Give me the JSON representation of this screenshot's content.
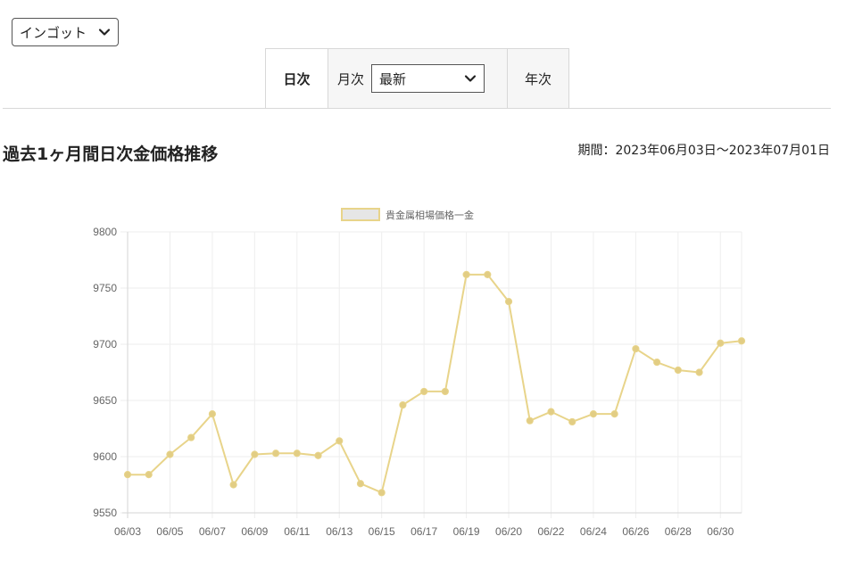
{
  "product_select": {
    "value": "インゴット"
  },
  "tabs": {
    "daily_label": "日次",
    "monthly_label": "月次",
    "monthly_select_value": "最新",
    "yearly_label": "年次"
  },
  "heading": {
    "title": "過去1ヶ月間日次金価格推移",
    "period": "期間：2023年06月03日～2023年07月01日"
  },
  "chart_data": {
    "type": "line",
    "title": "",
    "xlabel": "",
    "ylabel": "",
    "legend": {
      "position": "top",
      "entries": [
        "貴金属相場価格一金"
      ]
    },
    "grid": true,
    "ylim": [
      9550,
      9800
    ],
    "yticks": [
      9550,
      9600,
      9650,
      9700,
      9750,
      9800
    ],
    "xtick_labels": [
      "06/03",
      "06/05",
      "06/07",
      "06/09",
      "06/11",
      "06/13",
      "06/15",
      "06/17",
      "06/19",
      "06/20",
      "06/22",
      "06/24",
      "06/26",
      "06/28",
      "06/30"
    ],
    "series_color": "#e8d48a",
    "series": [
      {
        "name": "貴金属相場価格一金",
        "x": [
          "06/03",
          "06/04",
          "06/05",
          "06/06",
          "06/07",
          "06/08",
          "06/09",
          "06/10",
          "06/11",
          "06/12",
          "06/13",
          "06/14",
          "06/15",
          "06/16",
          "06/17",
          "06/18",
          "06/19",
          "06/19",
          "06/20",
          "06/21",
          "06/22",
          "06/23",
          "06/24",
          "06/25",
          "06/26",
          "06/27",
          "06/28",
          "06/29",
          "06/30",
          "07/01"
        ],
        "values": [
          9584,
          9584,
          9602,
          9617,
          9638,
          9575,
          9602,
          9603,
          9603,
          9601,
          9614,
          9576,
          9568,
          9646,
          9658,
          9658,
          9762,
          9762,
          9738,
          9632,
          9640,
          9631,
          9638,
          9638,
          9696,
          9684,
          9677,
          9675,
          9701,
          9703
        ]
      }
    ]
  }
}
